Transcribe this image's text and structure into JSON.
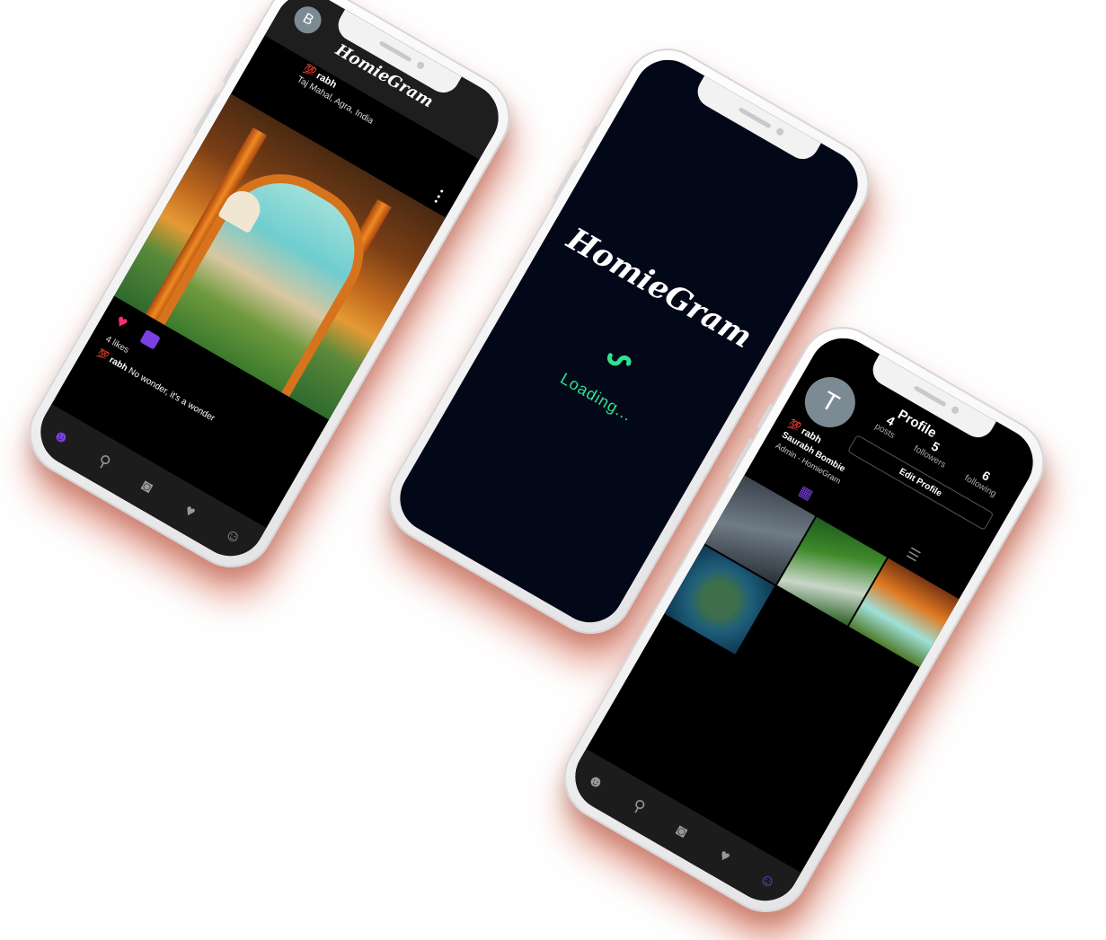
{
  "feed": {
    "brand": "HomieGram",
    "avatar_letter": "B",
    "user_prefix": "💯",
    "username": "rabh",
    "location": "Taj Mahal, Agra, India",
    "likes": "4 likes",
    "caption_user": "rabh",
    "caption_text": "No wonder, it's a wonder",
    "nav": [
      "home-icon",
      "search-icon",
      "camera-icon",
      "heart-icon",
      "profile-icon"
    ]
  },
  "loading": {
    "brand": "HomieGram",
    "text": "Loading...",
    "accent": "#2ee28f"
  },
  "profile": {
    "title": "Profile",
    "avatar_letter": "T",
    "posts_count": "4",
    "posts_label": "posts",
    "followers_count": "5",
    "followers_label": "followers",
    "following_count": "6",
    "following_label": "following",
    "edit_label": "Edit Profile",
    "user_prefix": "💯",
    "username": "rabh",
    "full_name": "Saurabh Bombie",
    "bio": "Admin - HomieGram"
  },
  "colors": {
    "accent_purple": "#7b3fe4",
    "like_pink": "#ff2d6f",
    "loading_bg": "#030818"
  }
}
